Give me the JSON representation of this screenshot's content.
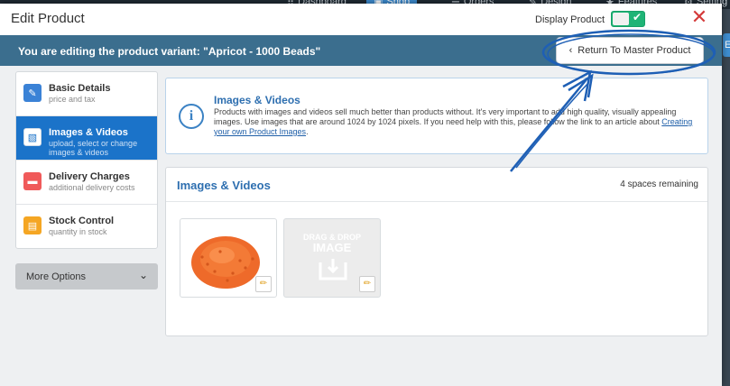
{
  "bg_nav": {
    "items": [
      "Dashboard",
      "Shop",
      "Orders",
      "Design",
      "Features",
      "Setting"
    ],
    "active": "Shop",
    "right_button": "Ec"
  },
  "modal": {
    "title": "Edit Product",
    "display_label": "Display Product",
    "display_on": true,
    "close_symbol": "✕"
  },
  "variant_bar": {
    "text": "You are editing the product variant: \"Apricot - 1000 Beads\"",
    "return_label": "Return To Master Product"
  },
  "sidebar": {
    "items": [
      {
        "title": "Basic Details",
        "sub": "price and tax",
        "icon": "pencil-icon",
        "color": "#3a82d6",
        "active": false
      },
      {
        "title": "Images & Videos",
        "sub": "upload, select or change images & videos",
        "icon": "image-icon",
        "color": "#ffffff",
        "active": true
      },
      {
        "title": "Delivery Charges",
        "sub": "additional delivery costs",
        "icon": "truck-icon",
        "color": "#f05a5a",
        "active": false
      },
      {
        "title": "Stock Control",
        "sub": "quantity in stock",
        "icon": "stock-icon",
        "color": "#f5a623",
        "active": false
      }
    ],
    "more_options": "More Options"
  },
  "info": {
    "title": "Images & Videos",
    "text": "Products with images and videos sell much better than products without. It's very important to add high quality, visually appealing images. Use images that are around 1024 by 1024 pixels. If you need help with this, please follow the link to an article about ",
    "link": "Creating your own Product Images",
    "after": "."
  },
  "media": {
    "title": "Images & Videos",
    "remaining": "4 spaces remaining",
    "dropzone_line1": "DRAG & DROP",
    "dropzone_line2": "IMAGE"
  },
  "colors": {
    "accent_blue": "#1b73c9",
    "variant_bar": "#3b6e8e",
    "toggle_green": "#1fb476",
    "close_red": "#d43a3a",
    "annotation": "#1e5fb5"
  }
}
